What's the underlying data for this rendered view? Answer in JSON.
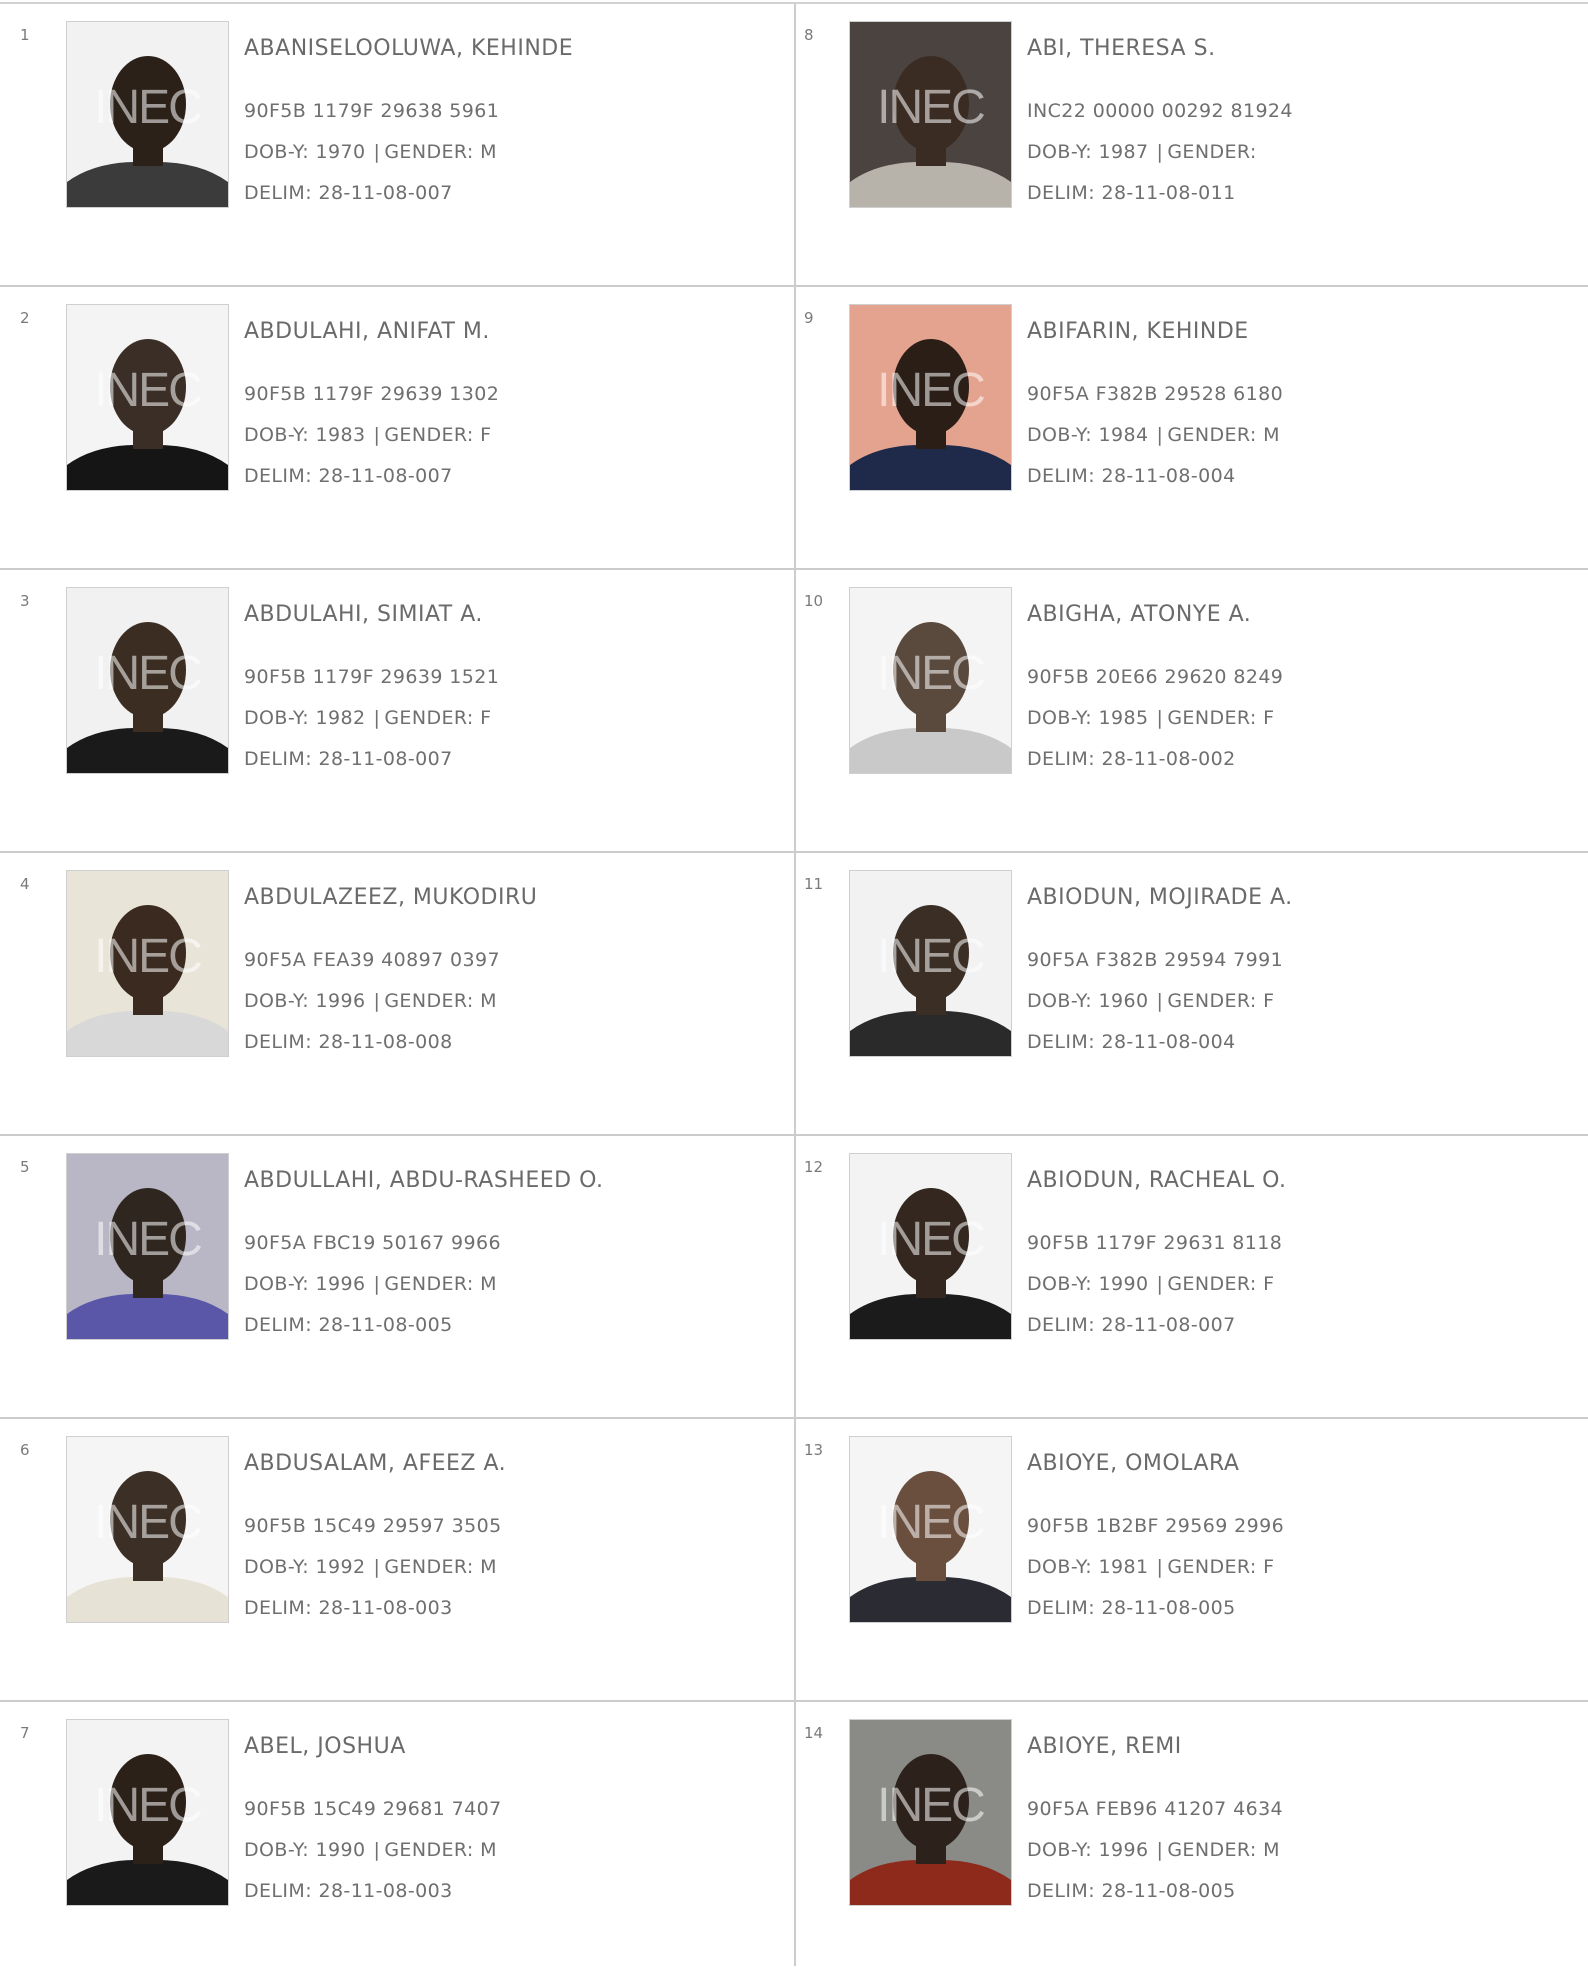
{
  "watermark": "INEC",
  "left_column": [
    {
      "serial": "1",
      "name": "ABANISELOOLUWA, KEHINDE",
      "vin": "90F5B 1179F 29638 5961",
      "dob_label": "DOB-Y: 1970",
      "gender_label": "GENDER: M",
      "delim": "DELIM: 28-11-08-007",
      "photo": {
        "bg": "#f2f2f2",
        "face": "#2b2119",
        "cloth": "#3b3b3b"
      }
    },
    {
      "serial": "2",
      "name": "ABDULAHI, ANIFAT M.",
      "vin": "90F5B 1179F 29639 1302",
      "dob_label": "DOB-Y: 1983",
      "gender_label": "GENDER: F",
      "delim": "DELIM: 28-11-08-007",
      "photo": {
        "bg": "#f4f4f4",
        "face": "#3a2e26",
        "cloth": "#151515"
      }
    },
    {
      "serial": "3",
      "name": "ABDULAHI, SIMIAT A.",
      "vin": "90F5B 1179F 29639 1521",
      "dob_label": "DOB-Y: 1982",
      "gender_label": "GENDER: F",
      "delim": "DELIM: 28-11-08-007",
      "photo": {
        "bg": "#f1f1f1",
        "face": "#3b2d22",
        "cloth": "#1a1a1a"
      }
    },
    {
      "serial": "4",
      "name": "ABDULAZEEZ, MUKODIRU",
      "vin": "90F5A FEA39 40897 0397",
      "dob_label": "DOB-Y: 1996",
      "gender_label": "GENDER: M",
      "delim": "DELIM: 28-11-08-008",
      "photo": {
        "bg": "#e9e4d8",
        "face": "#3a2a1f",
        "cloth": "#d8d8d8"
      }
    },
    {
      "serial": "5",
      "name": "ABDULLAHI, ABDU-RASHEED O.",
      "vin": "90F5A FBC19 50167 9966",
      "dob_label": "DOB-Y: 1996",
      "gender_label": "GENDER: M",
      "delim": "DELIM: 28-11-08-005",
      "photo": {
        "bg": "#b9b7c5",
        "face": "#2f2620",
        "cloth": "#5a56a8"
      }
    },
    {
      "serial": "6",
      "name": "ABDUSALAM, AFEEZ A.",
      "vin": "90F5B 15C49 29597 3505",
      "dob_label": "DOB-Y: 1992",
      "gender_label": "GENDER: M",
      "delim": "DELIM: 28-11-08-003",
      "photo": {
        "bg": "#f5f5f5",
        "face": "#3c2f26",
        "cloth": "#e6e2d5"
      }
    },
    {
      "serial": "7",
      "name": "ABEL, JOSHUA",
      "vin": "90F5B 15C49 29681 7407",
      "dob_label": "DOB-Y: 1990",
      "gender_label": "GENDER: M",
      "delim": "DELIM: 28-11-08-003",
      "photo": {
        "bg": "#f3f3f3",
        "face": "#2b2119",
        "cloth": "#1a1a1a"
      }
    }
  ],
  "right_column": [
    {
      "serial": "8",
      "name": "ABI, THERESA S.",
      "vin": "INC22 00000 00292 81924",
      "dob_label": "DOB-Y: 1987",
      "gender_label": "GENDER:",
      "delim": "DELIM: 28-11-08-011",
      "photo": {
        "bg": "#4a4340",
        "face": "#3a2c22",
        "cloth": "#b7b3aa"
      }
    },
    {
      "serial": "9",
      "name": "ABIFARIN, KEHINDE",
      "vin": "90F5A F382B 29528 6180",
      "dob_label": "DOB-Y: 1984",
      "gender_label": "GENDER: M",
      "delim": "DELIM: 28-11-08-004",
      "photo": {
        "bg": "#e4a38f",
        "face": "#2a1e17",
        "cloth": "#1f2a4a"
      }
    },
    {
      "serial": "10",
      "name": "ABIGHA, ATONYE A.",
      "vin": "90F5B 20E66 29620 8249",
      "dob_label": "DOB-Y: 1985",
      "gender_label": "GENDER: F",
      "delim": "DELIM: 28-11-08-002",
      "photo": {
        "bg": "#f4f4f4",
        "face": "#5a4a3e",
        "cloth": "#c9c9c9"
      }
    },
    {
      "serial": "11",
      "name": "ABIODUN, MOJIRADE A.",
      "vin": "90F5A F382B 29594 7991",
      "dob_label": "DOB-Y: 1960",
      "gender_label": "GENDER: F",
      "delim": "DELIM: 28-11-08-004",
      "photo": {
        "bg": "#f2f2f2",
        "face": "#3a2e25",
        "cloth": "#2a2a2a"
      }
    },
    {
      "serial": "12",
      "name": "ABIODUN, RACHEAL O.",
      "vin": "90F5B 1179F 29631 8118",
      "dob_label": "DOB-Y: 1990",
      "gender_label": "GENDER: F",
      "delim": "DELIM: 28-11-08-007",
      "photo": {
        "bg": "#f3f3f3",
        "face": "#33271f",
        "cloth": "#1b1b1b"
      }
    },
    {
      "serial": "13",
      "name": "ABIOYE, OMOLARA",
      "vin": "90F5B 1B2BF 29569 2996",
      "dob_label": "DOB-Y: 1981",
      "gender_label": "GENDER: F",
      "delim": "DELIM: 28-11-08-005",
      "photo": {
        "bg": "#f5f5f5",
        "face": "#6a4f3f",
        "cloth": "#2b2b33"
      }
    },
    {
      "serial": "14",
      "name": "ABIOYE, REMI",
      "vin": "90F5A FEB96 41207 4634",
      "dob_label": "DOB-Y: 1996",
      "gender_label": "GENDER: M",
      "delim": "DELIM: 28-11-08-005",
      "photo": {
        "bg": "#8a8b86",
        "face": "#2d221b",
        "cloth": "#8e2a1c"
      }
    }
  ]
}
